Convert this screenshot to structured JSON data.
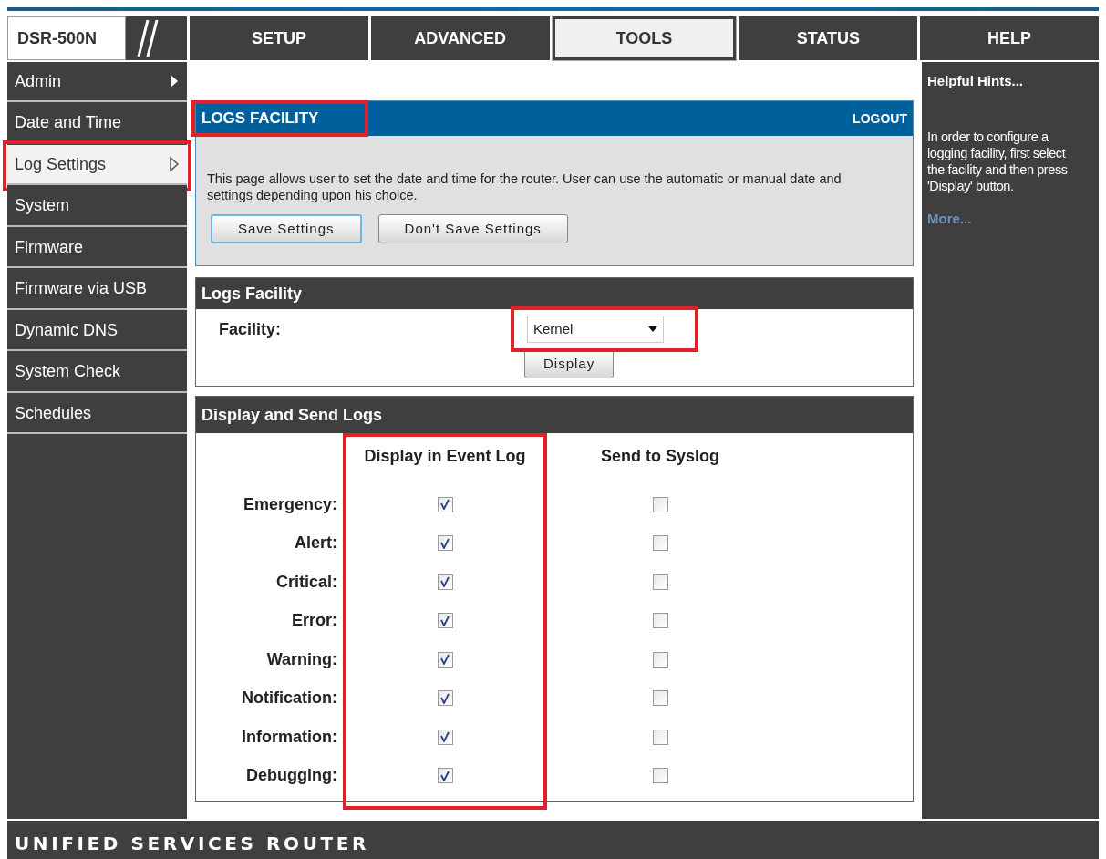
{
  "logo": {
    "model": "DSR-500N"
  },
  "tabs": [
    {
      "label": "SETUP",
      "selected": false
    },
    {
      "label": "ADVANCED",
      "selected": false
    },
    {
      "label": "TOOLS",
      "selected": true
    },
    {
      "label": "STATUS",
      "selected": false
    },
    {
      "label": "HELP",
      "selected": false
    }
  ],
  "sidebar": {
    "items": [
      {
        "label": "Admin",
        "selected": false,
        "has_submenu": true,
        "highlighted": false
      },
      {
        "label": "Date and Time",
        "selected": false,
        "has_submenu": false,
        "highlighted": false
      },
      {
        "label": "Log Settings",
        "selected": true,
        "has_submenu": true,
        "highlighted": true
      },
      {
        "label": "System",
        "selected": false,
        "has_submenu": false,
        "highlighted": false
      },
      {
        "label": "Firmware",
        "selected": false,
        "has_submenu": false,
        "highlighted": false
      },
      {
        "label": "Firmware via USB",
        "selected": false,
        "has_submenu": false,
        "highlighted": false
      },
      {
        "label": "Dynamic DNS",
        "selected": false,
        "has_submenu": false,
        "highlighted": false
      },
      {
        "label": "System Check",
        "selected": false,
        "has_submenu": false,
        "highlighted": false
      },
      {
        "label": "Schedules",
        "selected": false,
        "has_submenu": false,
        "highlighted": false
      }
    ]
  },
  "page": {
    "title": "LOGS FACILITY",
    "title_highlighted": true,
    "logout": "LOGOUT",
    "description": "This page allows user to set the date and time for the router. User can use the automatic or manual date and settings depending upon his choice.",
    "buttons": [
      "Save Settings",
      "Don't Save Settings"
    ]
  },
  "facility_section": {
    "title": "Logs Facility",
    "label": "Facility:",
    "value": "Kernel",
    "highlighted": true,
    "button": "Display"
  },
  "logs_section": {
    "title": "Display and Send Logs",
    "columns": [
      {
        "label": "Display in Event Log",
        "highlighted": true
      },
      {
        "label": "Send to Syslog",
        "highlighted": false
      }
    ],
    "rows": [
      {
        "label": "Emergency:",
        "event_log": true,
        "syslog": false
      },
      {
        "label": "Alert:",
        "event_log": true,
        "syslog": false
      },
      {
        "label": "Critical:",
        "event_log": true,
        "syslog": false
      },
      {
        "label": "Error:",
        "event_log": true,
        "syslog": false
      },
      {
        "label": "Warning:",
        "event_log": true,
        "syslog": false
      },
      {
        "label": "Notification:",
        "event_log": true,
        "syslog": false
      },
      {
        "label": "Information:",
        "event_log": true,
        "syslog": false
      },
      {
        "label": "Debugging:",
        "event_log": true,
        "syslog": false
      }
    ]
  },
  "help": {
    "title": "Helpful Hints...",
    "text": "In order to configure a logging facility, first select the facility and then press 'Display' button.",
    "more": "More..."
  },
  "footer": {
    "brand": "UNIFIED SERVICES ROUTER"
  }
}
